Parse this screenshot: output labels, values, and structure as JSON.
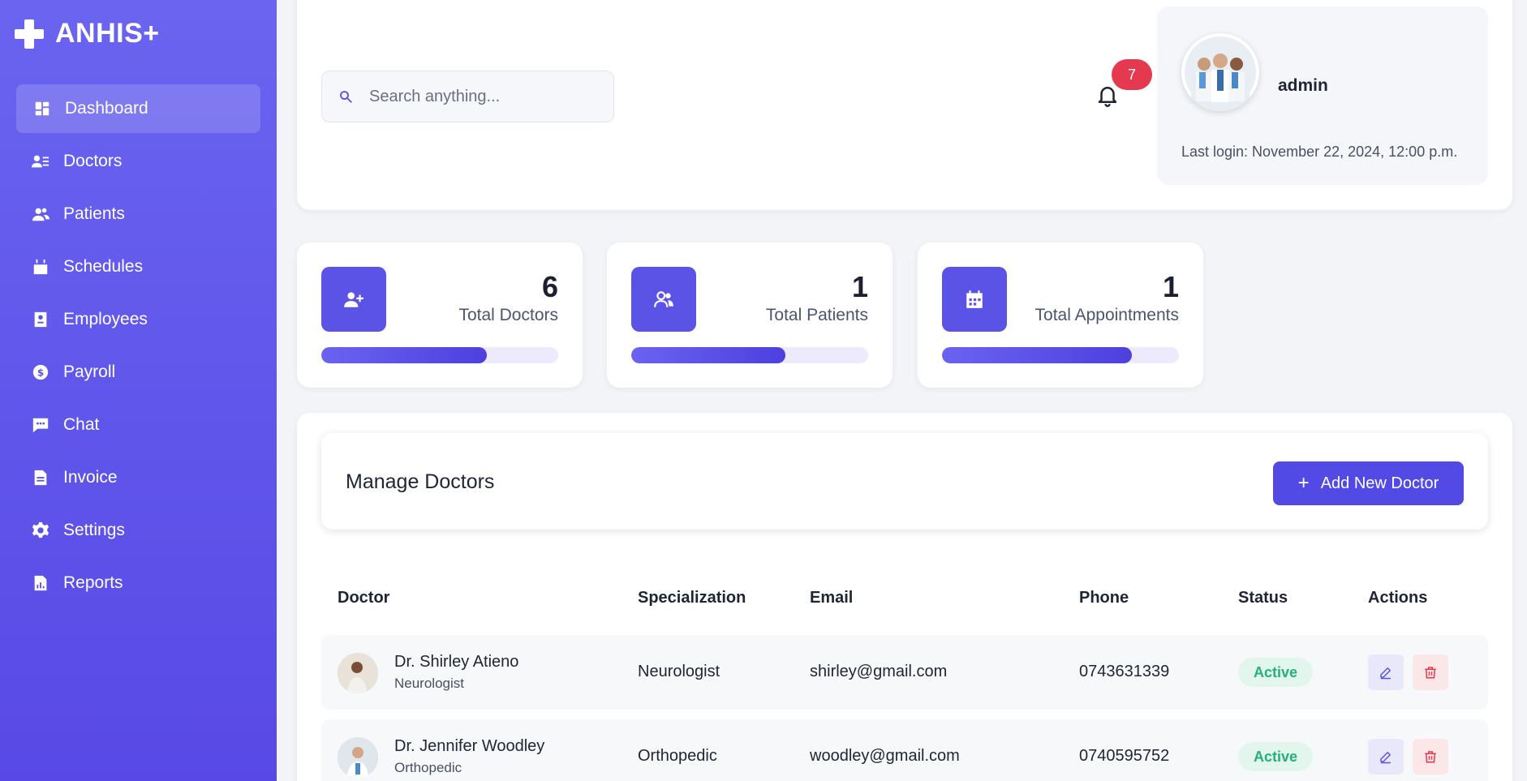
{
  "app": {
    "brand": "ANHIS+"
  },
  "sidebar": {
    "items": [
      {
        "label": "Dashboard",
        "icon": "dashboard-icon",
        "active": true
      },
      {
        "label": "Doctors",
        "icon": "doctors-icon"
      },
      {
        "label": "Patients",
        "icon": "patients-icon"
      },
      {
        "label": "Schedules",
        "icon": "calendar-icon"
      },
      {
        "label": "Employees",
        "icon": "id-badge-icon"
      },
      {
        "label": "Payroll",
        "icon": "dollar-icon"
      },
      {
        "label": "Chat",
        "icon": "chat-icon"
      },
      {
        "label": "Invoice",
        "icon": "invoice-icon"
      },
      {
        "label": "Settings",
        "icon": "gear-icon"
      },
      {
        "label": "Reports",
        "icon": "report-icon"
      }
    ]
  },
  "header": {
    "search_placeholder": "Search anything...",
    "notification_count": "7",
    "user_name": "admin",
    "last_login": "Last login: November 22, 2024, 12:00 p.m."
  },
  "stats": [
    {
      "value": "6",
      "label": "Total Doctors",
      "progress": 0.7,
      "icon": "user-plus-icon"
    },
    {
      "value": "1",
      "label": "Total Patients",
      "progress": 0.65,
      "icon": "users-icon"
    },
    {
      "value": "1",
      "label": "Total Appointments",
      "progress": 0.8,
      "icon": "calendar-icon"
    }
  ],
  "manage": {
    "title": "Manage Doctors",
    "add_label": "Add New Doctor",
    "columns": [
      "Doctor",
      "Specialization",
      "Email",
      "Phone",
      "Status",
      "Actions"
    ],
    "rows": [
      {
        "name": "Dr. Shirley Atieno",
        "sub": "Neurologist",
        "specialization": "Neurologist",
        "email": "shirley@gmail.com",
        "phone": "0743631339",
        "status": "Active"
      },
      {
        "name": "Dr. Jennifer Woodley",
        "sub": "Orthopedic",
        "specialization": "Orthopedic",
        "email": "woodley@gmail.com",
        "phone": "0740595752",
        "status": "Active"
      }
    ]
  },
  "colors": {
    "accent": "#5b52e6",
    "danger": "#e53950",
    "success": "#23b07a"
  }
}
